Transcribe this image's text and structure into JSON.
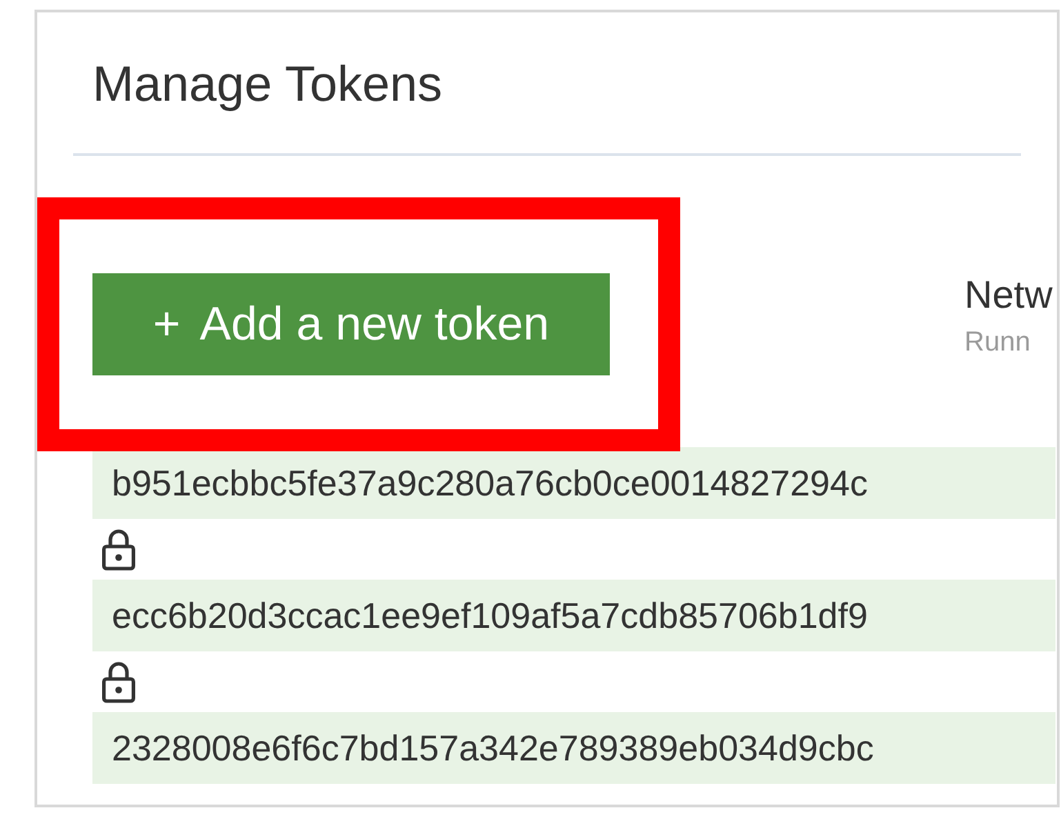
{
  "title": "Manage Tokens",
  "add_button": {
    "icon": "+",
    "label": "Add a new token",
    "highlighted": true
  },
  "side_info": {
    "heading": "Netw",
    "subheading": "Runn"
  },
  "tokens": [
    {
      "value": "b951ecbbc5fe37a9c280a76cb0ce0014827294c",
      "locked": true
    },
    {
      "value": "ecc6b20d3ccac1ee9ef109af5a7cdb85706b1df9",
      "locked": true
    },
    {
      "value": "2328008e6f6c7bd157a342e789389eb034d9cbc",
      "locked": false
    }
  ]
}
